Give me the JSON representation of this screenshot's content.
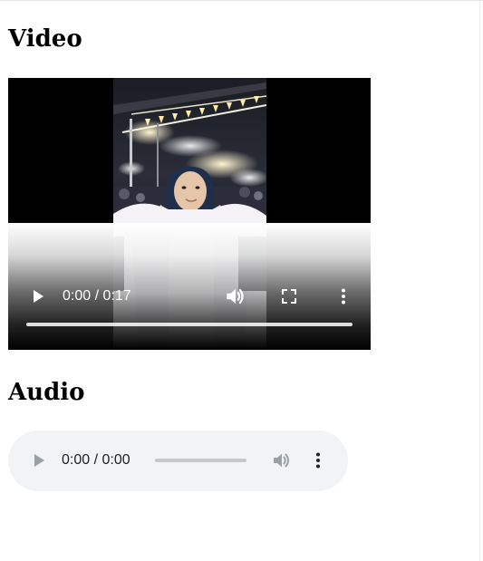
{
  "video_section": {
    "heading": "Video",
    "player": {
      "time_display": "0:00 / 0:17",
      "progress": 0,
      "icons": {
        "play": "play-icon",
        "volume": "volume-icon",
        "fullscreen": "fullscreen-icon",
        "more": "more-options-icon"
      }
    }
  },
  "audio_section": {
    "heading": "Audio",
    "player": {
      "time_display": "0:00 / 0:00",
      "progress": 0,
      "icons": {
        "play": "play-icon",
        "volume": "volume-icon",
        "more": "more-options-icon"
      }
    }
  },
  "colors": {
    "audio_player_background": "#f1f3f4",
    "video_controls_foreground": "#ffffff",
    "audio_disabled_icon": "#9aa0a6",
    "audio_track": "#c8c8c8"
  }
}
